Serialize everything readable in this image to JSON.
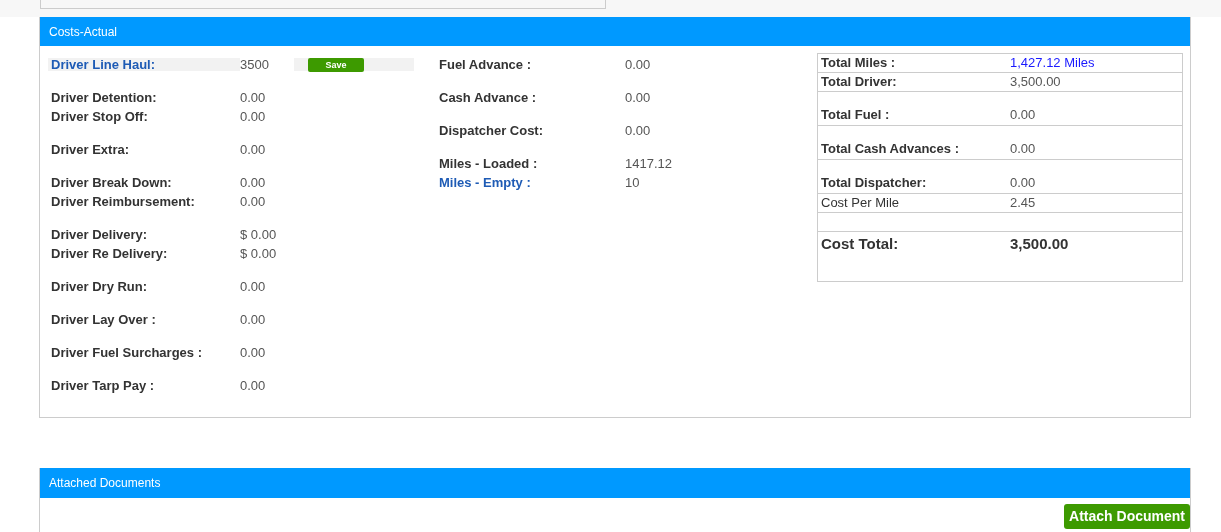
{
  "costs_panel": {
    "title": "Costs-Actual",
    "driver_groups": [
      [
        {
          "label": "Driver Line Haul:",
          "value": "3500",
          "link": true,
          "kind": "edit",
          "button": "Save"
        }
      ],
      [
        {
          "label": "Driver Detention:",
          "value": "0.00",
          "link": false,
          "kind": "text"
        },
        {
          "label": "Driver Stop Off:",
          "value": "0.00",
          "link": false,
          "kind": "text"
        }
      ],
      [
        {
          "label": "Driver Extra:",
          "value": "0.00",
          "link": false,
          "kind": "text"
        }
      ],
      [
        {
          "label": "Driver Break Down:",
          "value": "0.00",
          "link": false,
          "kind": "text"
        },
        {
          "label": "Driver Reimbursement:",
          "value": "0.00",
          "link": false,
          "kind": "text"
        }
      ],
      [
        {
          "label": "Driver Delivery:",
          "value": "$ 0.00",
          "link": false,
          "kind": "text"
        },
        {
          "label": "Driver Re Delivery:",
          "value": "$ 0.00",
          "link": false,
          "kind": "text"
        }
      ],
      [
        {
          "label": "Driver Dry Run:",
          "value": "0.00",
          "link": false,
          "kind": "text"
        }
      ],
      [
        {
          "label": "Driver Lay Over :",
          "value": "0.00",
          "link": false,
          "kind": "text"
        }
      ],
      [
        {
          "label": "Driver Fuel Surcharges :",
          "value": "0.00",
          "link": false,
          "kind": "text"
        }
      ],
      [
        {
          "label": "Driver Tarp Pay :",
          "value": "0.00",
          "link": false,
          "kind": "text"
        }
      ]
    ],
    "other_groups": [
      [
        {
          "label": "Fuel Advance :",
          "value": "0.00",
          "link": false,
          "kind": "text"
        }
      ],
      [
        {
          "label": "Cash Advance :",
          "value": "0.00",
          "link": false,
          "kind": "text"
        }
      ],
      [
        {
          "label": "Dispatcher Cost:",
          "value": "0.00",
          "link": false,
          "kind": "text"
        }
      ],
      [
        {
          "label": "Miles - Loaded :",
          "value": "1417.12",
          "link": false,
          "kind": "text"
        },
        {
          "label": "Miles - Empty :",
          "value": "10",
          "link": true,
          "kind": "text"
        }
      ]
    ],
    "totals": [
      {
        "label": "Total Miles :",
        "value": "1,427.12 Miles",
        "kind": "miles"
      },
      {
        "label": "Total Driver:",
        "value": "3,500.00",
        "kind": "row"
      },
      {
        "label": "Total Fuel :",
        "value": "0.00",
        "kind": "tall"
      },
      {
        "label": "Total Cash Advances :",
        "value": "0.00",
        "kind": "tall"
      },
      {
        "label": "Total Dispatcher:",
        "value": "0.00",
        "kind": "tall"
      },
      {
        "label": "Cost Per Mile",
        "value": "2.45",
        "kind": "row"
      },
      {
        "label": "Cost Total:",
        "value": "3,500.00",
        "kind": "total"
      }
    ]
  },
  "documents_panel": {
    "title": "Attached Documents",
    "button": "Attach Document"
  }
}
